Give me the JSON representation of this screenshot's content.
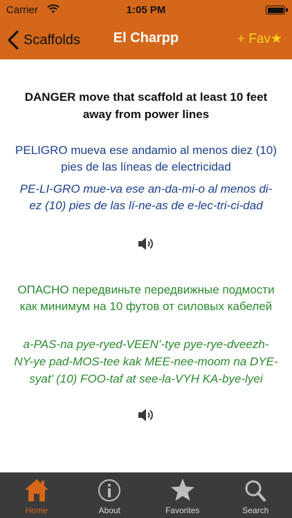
{
  "status": {
    "carrier": "Carrier",
    "time": "1:05 PM"
  },
  "nav": {
    "back_label": "Scaffolds",
    "title": "El Charpp",
    "fav_label": "+ Fav★"
  },
  "phrase": {
    "english": "DANGER move that scaffold at least 10 feet away from power lines",
    "spanish": "PELIGRO mueva ese andamio al menos diez (10) pies de las líneas de electricidad",
    "spanish_pronunciation": "PE-LI-GRO mue-va ese an-da-mi-o al menos di-ez (10) pies de las lí-ne-as de e-lec-tri-ci-dad",
    "russian": "ОПАСНО передвиньте передвижные подмости как минимум на 10 футов от силовых кабелей",
    "russian_pronunciation": "a-PAS-na pye-ryed-VEEN’-tye pye-rye-dveezh-NY-ye pad-MOS-tee kak MEE-nee-moom na DYE-syat’ (10) FOO-taf at see-la-VYH KA-bye-lyei"
  },
  "tabs": [
    {
      "label": "Home",
      "icon": "home-icon",
      "active": true
    },
    {
      "label": "About",
      "icon": "info-icon",
      "active": false
    },
    {
      "label": "Favorites",
      "icon": "star-icon",
      "active": false
    },
    {
      "label": "Search",
      "icon": "search-icon",
      "active": false
    }
  ],
  "colors": {
    "accent": "#d4671a",
    "favorite": "#ffd21a",
    "spanish_text": "#1a3f8c",
    "russian_text": "#2a8a2e",
    "tab_bar": "#3b3b3b"
  }
}
